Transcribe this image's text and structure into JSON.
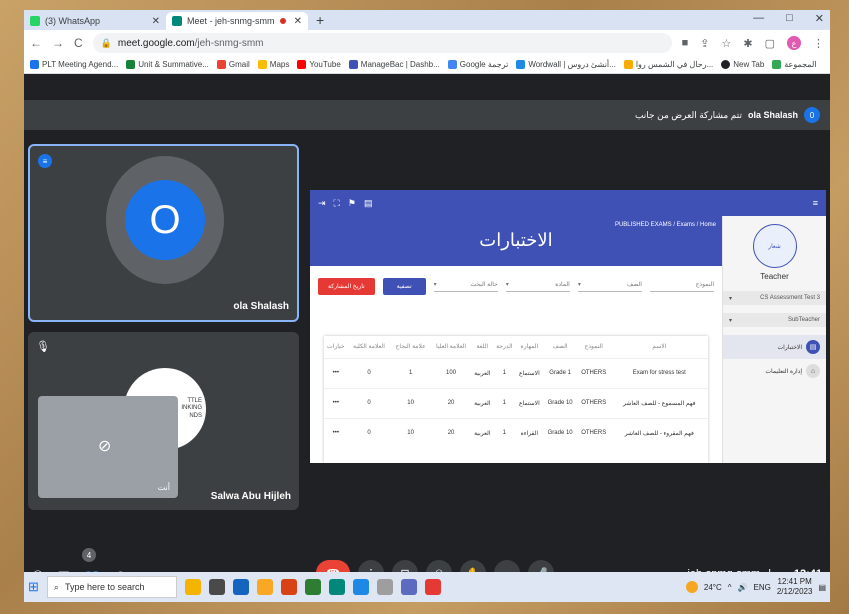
{
  "tabs": [
    {
      "title": "(3) WhatsApp",
      "fav": "#25d366"
    },
    {
      "title": "Meet - jeh-snmg-smm",
      "fav": "#00897b"
    }
  ],
  "new_tab": "+",
  "window_controls": [
    "—",
    "□",
    "✕"
  ],
  "address": {
    "host": "meet.google.com",
    "path": "/jeh-snmg-smm"
  },
  "bookmarks": [
    {
      "label": "PLT Meeting Agend...",
      "color": "#1a73e8"
    },
    {
      "label": "Unit & Summative...",
      "color": "#188038"
    },
    {
      "label": "Gmail",
      "color": "#ea4335"
    },
    {
      "label": "Maps",
      "color": "#fbbc04"
    },
    {
      "label": "YouTube",
      "color": "#ff0000"
    },
    {
      "label": "ManageBac | Dashb...",
      "color": "#3f51b5"
    },
    {
      "label": "Google ترجمة",
      "color": "#4285f4"
    },
    {
      "label": "Wordwall | أنشئ دروس...",
      "color": "#1e88e5"
    },
    {
      "label": "رحال في الشمس روا...",
      "color": "#f9ab00"
    },
    {
      "label": "New Tab",
      "color": "#202124"
    },
    {
      "label": "المجموعة",
      "color": "#34a853"
    }
  ],
  "meet": {
    "presenter_count": "0",
    "notice_name": "ola Shalash",
    "notice_text": "تتم مشاركة العرض من جانب",
    "tile1": {
      "initial": "O",
      "name": "ola Shalash"
    },
    "tile2": {
      "name": "Salwa Abu Hijleh",
      "self_label": "أنت",
      "logo_text": "TTLE\nINKING\nNDS"
    },
    "meeting_code": "jeh-snmg-smm",
    "time": "12:41",
    "time_suffix": "م",
    "people_badge": "4"
  },
  "presentation": {
    "breadcrumb": "PUBLISHED EXAMS / Exams / Home",
    "title": "الاختبارات",
    "btn_red": "تاريخ المشاركة",
    "btn_blue": "تصفية",
    "filters": [
      "حالة البحث",
      "المادة",
      "الصف",
      "النموذج"
    ],
    "role": "Teacher",
    "selects": [
      "CS Assessment Test 3",
      "SubTeacher"
    ],
    "menu": [
      "الاختبارات",
      "إدارة التعليمات"
    ],
    "columns": [
      "خيارات",
      "العلامة الكلية",
      "علامة النجاح",
      "العلامة العليا",
      "اللغة",
      "الدرجة",
      "المهارة",
      "الصف",
      "النموذج",
      "الاسم"
    ],
    "rows": [
      [
        "•••",
        "0",
        "1",
        "100",
        "العربية",
        "1",
        "الاستماع",
        "Grade 1",
        "OTHERS",
        "Exam for stress test"
      ],
      [
        "•••",
        "0",
        "10",
        "20",
        "العربية",
        "1",
        "الاستماع",
        "Grade 10",
        "OTHERS",
        "فهم المسموع - للصف العاشر"
      ],
      [
        "•••",
        "0",
        "10",
        "20",
        "العربية",
        "1",
        "القراءة",
        "Grade 10",
        "OTHERS",
        "فهم المقروء - للصف العاشر"
      ]
    ]
  },
  "taskbar": {
    "search_placeholder": "Type here to search",
    "temp": "24°C",
    "lang": "ENG",
    "clock_time": "12:41 PM",
    "clock_date": "2/12/2023"
  }
}
